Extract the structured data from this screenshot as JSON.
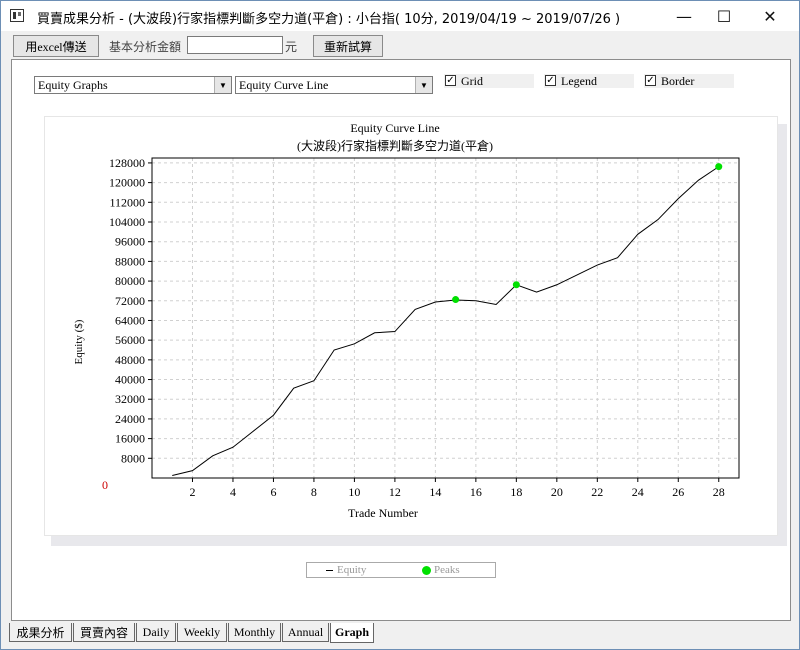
{
  "window": {
    "title": "買賣成果分析 - (大波段)行家指標判斷多空力道(平倉) : 小台指( 10分, 2019/04/19 ~ 2019/07/26 )",
    "minimize": "—",
    "maximize": "☐",
    "close": "✕"
  },
  "toolbar": {
    "excel_button": "用excel傳送",
    "base_amount_label": "基本分析金額",
    "base_amount_value": "",
    "unit_label": "元",
    "recalc_button": "重新試算"
  },
  "controls": {
    "graph_type": "Equity Graphs",
    "graph_style": "Equity Curve Line",
    "grid_label": "Grid",
    "grid_checked": true,
    "legend_label": "Legend",
    "legend_checked": true,
    "border_label": "Border",
    "border_checked": true,
    "check_mark": "✓",
    "dropdown_arrow": "▼"
  },
  "chart_data": {
    "type": "line",
    "title": "Equity Curve Line",
    "subtitle": "(大波段)行家指標判斷多空力道(平倉)",
    "xlabel": "Trade Number",
    "ylabel": "Equity ($)",
    "zero_label": "0",
    "xlim": [
      0,
      29
    ],
    "ylim": [
      0,
      130000
    ],
    "xticks": [
      2,
      4,
      6,
      8,
      10,
      12,
      14,
      16,
      18,
      20,
      22,
      24,
      26,
      28
    ],
    "yticks": [
      8000,
      16000,
      24000,
      32000,
      40000,
      48000,
      56000,
      64000,
      72000,
      80000,
      88000,
      96000,
      104000,
      112000,
      120000,
      128000
    ],
    "grid": true,
    "series": [
      {
        "name": "Equity",
        "color": "#000000",
        "x": [
          1,
          2,
          3,
          4,
          5,
          6,
          7,
          8,
          9,
          10,
          11,
          12,
          13,
          14,
          15,
          16,
          17,
          18,
          19,
          20,
          21,
          22,
          23,
          24,
          25,
          26,
          27,
          28
        ],
        "values": [
          1000,
          3000,
          9000,
          12500,
          19000,
          25500,
          36500,
          39500,
          52000,
          54500,
          59000,
          59500,
          68500,
          71500,
          72300,
          72000,
          70500,
          78500,
          75500,
          78500,
          82500,
          86500,
          89500,
          99000,
          105000,
          113500,
          121000,
          126500
        ]
      },
      {
        "name": "Peaks",
        "color": "#00e000",
        "x": [
          15,
          18,
          28
        ],
        "values": [
          72500,
          78500,
          126500
        ]
      }
    ]
  },
  "legend": {
    "equity_label": "Equity",
    "peaks_label": "Peaks"
  },
  "tabs": [
    {
      "label": "成果分析",
      "active": false
    },
    {
      "label": "買賣內容",
      "active": false
    },
    {
      "label": "Daily",
      "active": false
    },
    {
      "label": "Weekly",
      "active": false
    },
    {
      "label": "Monthly",
      "active": false
    },
    {
      "label": "Annual",
      "active": false
    },
    {
      "label": "Graph",
      "active": true
    }
  ]
}
